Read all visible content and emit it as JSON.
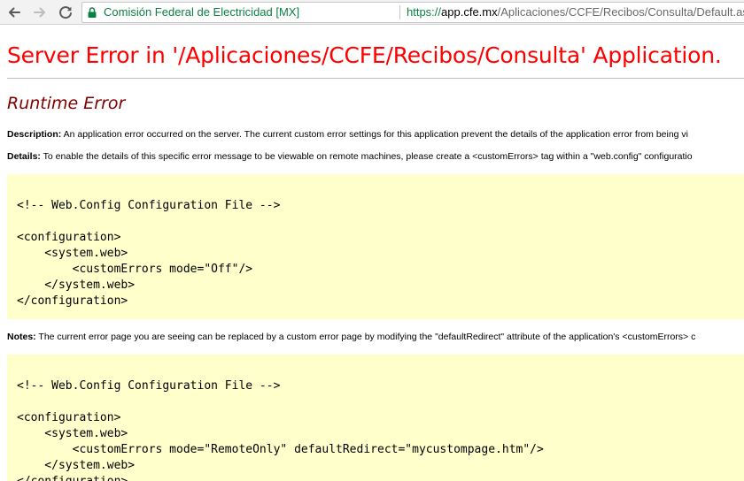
{
  "browser": {
    "site_name": "Comisión Federal de Electricidad [MX]",
    "url_scheme": "https://",
    "url_host": "app.cfe.mx",
    "url_path": "/Aplicaciones/CCFE/Recibos/Consulta/Default.aspx",
    "colors": {
      "secure": "#0b8043",
      "toolbar": "#f2f2f2"
    }
  },
  "page": {
    "title": "Server Error in '/Aplicaciones/CCFE/Recibos/Consulta' Application.",
    "subtitle": "Runtime Error",
    "description_label": "Description:",
    "description_text": " An application error occurred on the server. The current custom error settings for this application prevent the details of the application error from being vi",
    "details_label": "Details:",
    "details_text": " To enable the details of this specific error message to be viewable on remote machines, please create a <customErrors> tag within a \"web.config\" configuratio",
    "notes_label": "Notes:",
    "notes_text": " The current error page you are seeing can be replaced by a custom error page by modifying the \"defaultRedirect\" attribute of the application's <customErrors> c",
    "code_block_1": "<!-- Web.Config Configuration File -->\n\n<configuration>\n    <system.web>\n        <customErrors mode=\"Off\"/>\n    </system.web>\n</configuration>",
    "code_block_2": "<!-- Web.Config Configuration File -->\n\n<configuration>\n    <system.web>\n        <customErrors mode=\"RemoteOnly\" defaultRedirect=\"mycustompage.htm\"/>\n    </system.web>\n</configuration>",
    "colors": {
      "title": "#ff0000",
      "subtitle": "#800000",
      "code_bg": "#ffffcc"
    }
  }
}
